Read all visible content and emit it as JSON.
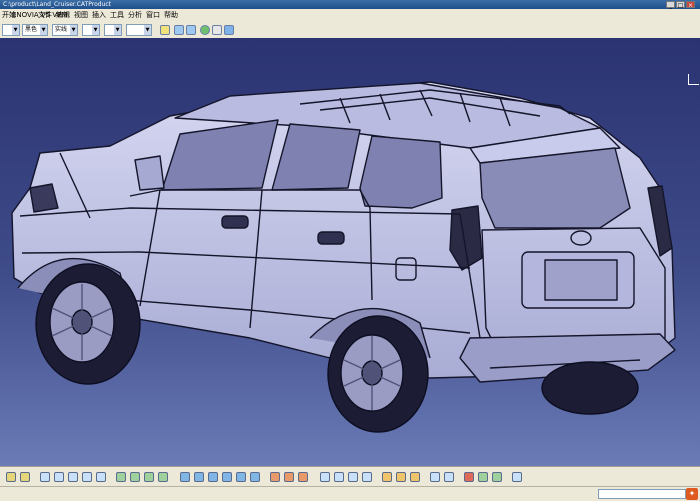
{
  "window": {
    "title": "C:\\product\\Land_Cruiser.CATProduct"
  },
  "menu": {
    "items": [
      "开始",
      "ENOVIA V5 VPM",
      "文件",
      "编辑",
      "视图",
      "插入",
      "工具",
      "分析",
      "窗口",
      "帮助"
    ]
  },
  "toolbar": {
    "combos": [
      "",
      "黑色",
      "实线",
      "",
      ""
    ]
  },
  "colors": {
    "viewport_top": "#2b3372",
    "viewport_bottom": "#6a7bb6",
    "wire": "#14142a",
    "body": "#c4c6e8"
  }
}
